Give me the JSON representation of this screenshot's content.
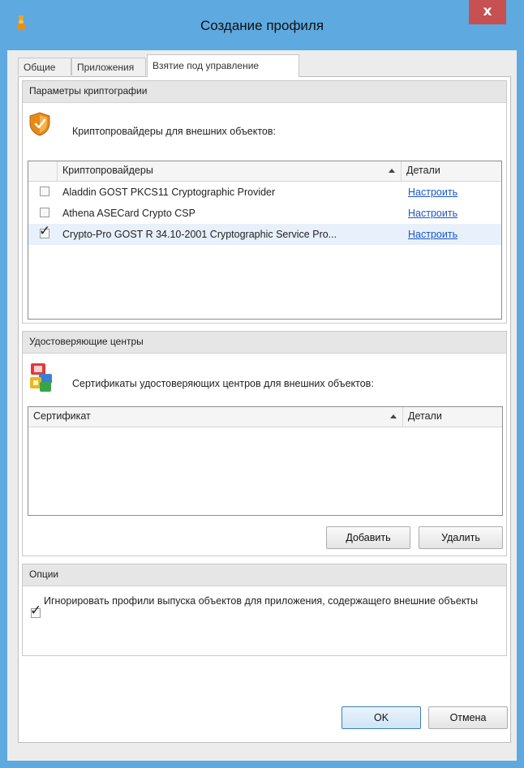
{
  "window": {
    "title": "Создание профиля",
    "close_glyph": "x",
    "accent_color": "#5ea9e0",
    "close_color": "#c75050"
  },
  "tabs": [
    {
      "label": "Общие",
      "active": false
    },
    {
      "label": "Приложения",
      "active": false
    },
    {
      "label": "Взятие под управление",
      "active": true
    }
  ],
  "crypto": {
    "header": "Параметры криптографии",
    "icon": "shield-icon",
    "description": "Криптопровайдеры для внешних объектов:",
    "columns": {
      "name": "Криптопровайдеры",
      "details": "Детали"
    },
    "rows": [
      {
        "checked": false,
        "name": "Aladdin GOST PKCS11 Cryptographic Provider",
        "link": "Настроить"
      },
      {
        "checked": false,
        "name": "Athena ASECard Crypto CSP",
        "link": "Настроить"
      },
      {
        "checked": true,
        "name": "Crypto-Pro GOST R 34.10-2001 Cryptographic Service Pro...",
        "link": "Настроить"
      }
    ]
  },
  "ca": {
    "header": "Удостоверяющие центры",
    "icon": "certificates-icon",
    "description": "Сертификаты удостоверяющих центров для внешних объектов:",
    "columns": {
      "name": "Сертификат",
      "details": "Детали"
    },
    "add_label": "Добавить",
    "remove_label": "Удалить"
  },
  "options": {
    "header": "Опции",
    "ignore_checked": true,
    "ignore_label": "Игнорировать профили выпуска объектов для приложения, содержащего внешние объекты"
  },
  "footer": {
    "ok_label": "OK",
    "cancel_label": "Отмена"
  }
}
